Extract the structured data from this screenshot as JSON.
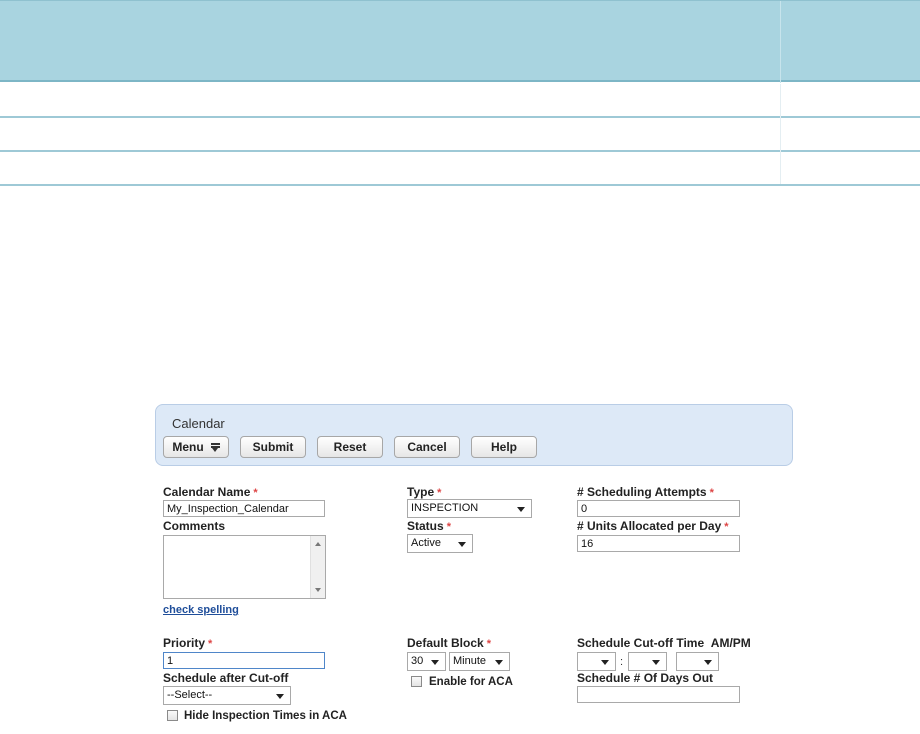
{
  "panel": {
    "title": "Calendar",
    "buttons": {
      "menu": "Menu",
      "submit": "Submit",
      "reset": "Reset",
      "cancel": "Cancel",
      "help": "Help"
    }
  },
  "form": {
    "calendar_name": {
      "label": "Calendar Name",
      "required": "*",
      "value": "My_Inspection_Calendar"
    },
    "comments": {
      "label": "Comments",
      "value": ""
    },
    "check_spelling": "check spelling",
    "type": {
      "label": "Type",
      "required": "*",
      "value": "INSPECTION"
    },
    "status": {
      "label": "Status",
      "required": "*",
      "value": "Active"
    },
    "scheduling_attempts": {
      "label": "# Scheduling Attempts",
      "required": "*",
      "value": "0"
    },
    "units_allocated": {
      "label": "# Units Allocated per Day",
      "required": "*",
      "value": "16"
    },
    "priority": {
      "label": "Priority",
      "required": "*",
      "value": "1"
    },
    "schedule_after_cutoff": {
      "label": "Schedule after Cut-off",
      "value": "--Select--"
    },
    "hide_inspection_times": {
      "label": "Hide Inspection Times in ACA",
      "checked": false
    },
    "default_block": {
      "label": "Default Block",
      "required": "*",
      "amount": "30",
      "unit": "Minute"
    },
    "enable_for_aca": {
      "label": "Enable for ACA",
      "checked": false
    },
    "cutoff_time": {
      "label": "Schedule Cut-off Time",
      "ampm_label": "AM/PM",
      "hour": "",
      "separator": ":",
      "minute": "",
      "ampm": ""
    },
    "days_out": {
      "label": "Schedule # Of Days Out",
      "value": ""
    }
  },
  "colors": {
    "band": "#a9d4e0",
    "panel": "#dde9f7",
    "required": "#dd4444",
    "link": "#1f4e9a"
  }
}
